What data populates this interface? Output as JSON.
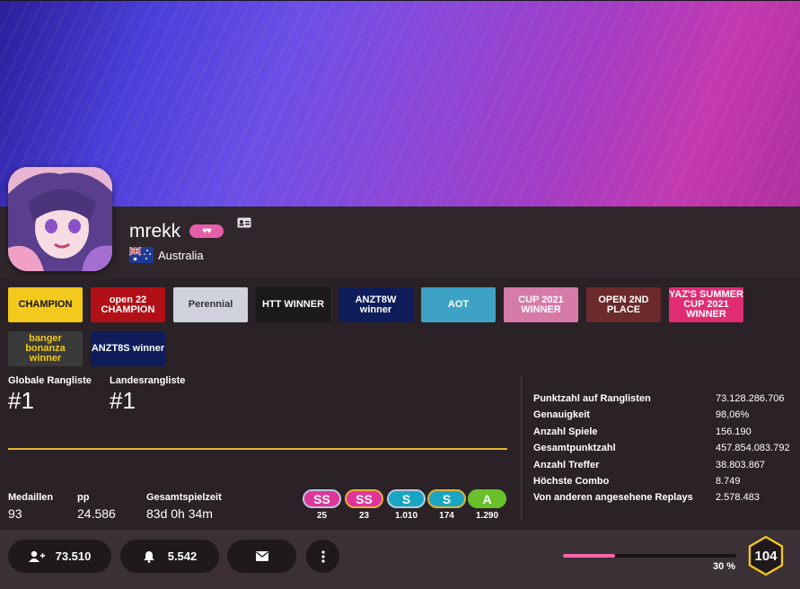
{
  "profile": {
    "username": "mrekk",
    "supporter_icon": "heart-icon",
    "country": "Australia"
  },
  "badges": [
    {
      "name": "badge-champion",
      "text": "CHAMPION",
      "bg": "#f2c91c",
      "fg": "#111"
    },
    {
      "name": "badge-open22-champion",
      "text": "open 22 CHAMPION",
      "bg": "#b01016",
      "fg": "#fff"
    },
    {
      "name": "badge-perennial",
      "text": "Perennial",
      "bg": "#cfd2dd",
      "fg": "#333"
    },
    {
      "name": "badge-htt-winner",
      "text": "HTT WINNER",
      "bg": "#1a1a1a",
      "fg": "#fff"
    },
    {
      "name": "badge-anzt8w",
      "text": "ANZT8W winner",
      "bg": "#0e1d5a",
      "fg": "#fff"
    },
    {
      "name": "badge-aot",
      "text": "AOT",
      "bg": "#3ea2c4",
      "fg": "#fff"
    },
    {
      "name": "badge-ujcup-2021",
      "text": "CUP 2021 WINNER",
      "bg": "#d67aa8",
      "fg": "#fff"
    },
    {
      "name": "badge-open-2nd",
      "text": "OPEN 2ND PLACE",
      "bg": "#6b2a2c",
      "fg": "#fff"
    },
    {
      "name": "badge-yaz-summer-cup",
      "text": "YAZ'S SUMMER CUP 2021 WINNER",
      "bg": "#e02c72",
      "fg": "#fff"
    },
    {
      "name": "badge-banger-bonanza",
      "text": "banger bonanza winner",
      "bg": "#3a3a3a",
      "fg": "#f2c91c"
    },
    {
      "name": "badge-anzt8s",
      "text": "ANZT8S winner",
      "bg": "#0e1d5a",
      "fg": "#fff"
    }
  ],
  "ranks": {
    "global_label": "Globale Rangliste",
    "global_value": "#1",
    "country_label": "Landesrangliste",
    "country_value": "#1"
  },
  "summary": {
    "medals_label": "Medaillen",
    "medals_value": "93",
    "pp_label": "pp",
    "pp_value": "24.586",
    "playtime_label": "Gesamtspielzeit",
    "playtime_value": "83d 0h 34m"
  },
  "grades": [
    {
      "label": "SS",
      "count": "25",
      "color": "#e0359b",
      "ring": "#b7c8d8"
    },
    {
      "label": "SS",
      "count": "23",
      "color": "#e0359b",
      "ring": "#e0b136"
    },
    {
      "label": "S",
      "count": "1.010",
      "color": "#1aa5c4",
      "ring": "#b7c8d8"
    },
    {
      "label": "S",
      "count": "174",
      "color": "#1aa5c4",
      "ring": "#e0b136"
    },
    {
      "label": "A",
      "count": "1.290",
      "color": "#69c02a",
      "ring": "#69c02a"
    }
  ],
  "stats": [
    {
      "name": "Punktzahl auf Ranglisten",
      "value": "73.128.286.706"
    },
    {
      "name": "Genauigkeit",
      "value": "98,06%"
    },
    {
      "name": "Anzahl Spiele",
      "value": "156.190"
    },
    {
      "name": "Gesamtpunktzahl",
      "value": "457.854.083.792"
    },
    {
      "name": "Anzahl Treffer",
      "value": "38.803.867"
    },
    {
      "name": "Höchste Combo",
      "value": "8.749"
    },
    {
      "name": "Von anderen angesehene Replays",
      "value": "2.578.483"
    }
  ],
  "actions": {
    "followers": "73.510",
    "subscribers": "5.542"
  },
  "level": {
    "value": "104",
    "progress_percent": 30,
    "progress_label": "30 %"
  },
  "colors": {
    "accent_pink": "#ff66aa",
    "gold": "#e1b530"
  }
}
